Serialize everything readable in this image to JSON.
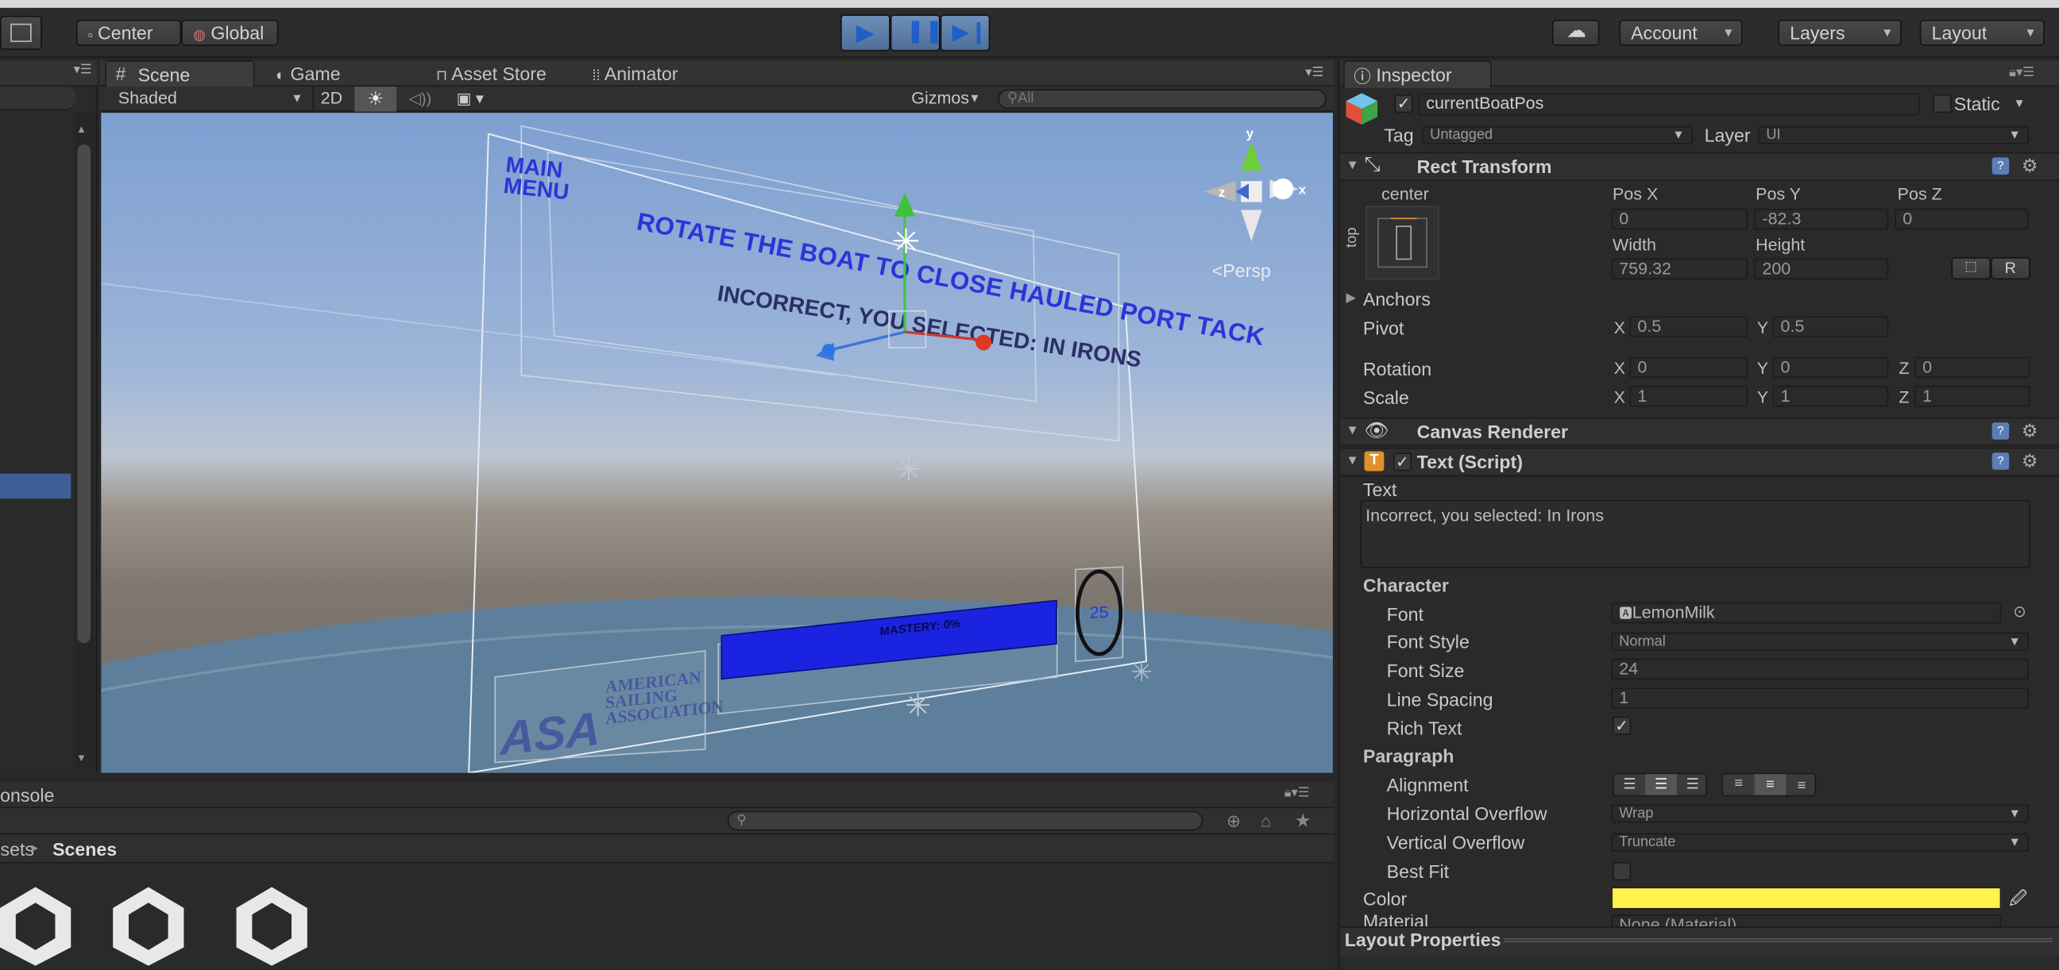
{
  "toolbar": {
    "pivot_label": "Center",
    "space_label": "Global",
    "account_label": "Account",
    "layers_label": "Layers",
    "layout_label": "Layout"
  },
  "tabs": {
    "scene": "Scene",
    "game": "Game",
    "asset_store": "Asset Store",
    "animator": "Animator",
    "inspector": "Inspector",
    "console": "Console"
  },
  "scene_toolbar": {
    "shading": "Shaded",
    "mode_2d": "2D",
    "gizmos": "Gizmos",
    "search_placeholder": "All"
  },
  "scene_view": {
    "main_menu": "MAIN MENU",
    "instruction": "ROTATE THE BOAT TO CLOSE HAULED PORT TACK",
    "feedback": "INCORRECT, YOU SELECTED: IN IRONS",
    "mastery": "MASTERY: 0%",
    "timer": "25",
    "asa_logo": "ASA",
    "asa_name": "AMERICAN SAILING ASSOCIATION",
    "persp": "Persp",
    "axis_y": "y",
    "axis_x": "x",
    "axis_z": "z"
  },
  "project": {
    "breadcrumb_root": "Assets",
    "breadcrumb_current": "Scenes"
  },
  "inspector": {
    "object_name": "currentBoatPos",
    "static_label": "Static",
    "tag_label": "Tag",
    "tag_value": "Untagged",
    "layer_label": "Layer",
    "layer_value": "UI",
    "rect_transform": {
      "title": "Rect Transform",
      "anchor_h": "center",
      "anchor_v": "top",
      "pos_x_label": "Pos X",
      "pos_y_label": "Pos Y",
      "pos_z_label": "Pos Z",
      "pos_x": "0",
      "pos_y": "-82.3",
      "pos_z": "0",
      "width_label": "Width",
      "height_label": "Height",
      "width": "759.32",
      "height": "200",
      "r_button": "R",
      "anchors_label": "Anchors",
      "pivot_label": "Pivot",
      "pivot_x": "0.5",
      "pivot_y": "0.5",
      "rotation_label": "Rotation",
      "rot_x": "0",
      "rot_y": "0",
      "rot_z": "0",
      "scale_label": "Scale",
      "scale_x": "1",
      "scale_y": "1",
      "scale_z": "1",
      "x": "X",
      "y": "Y",
      "z": "Z"
    },
    "canvas_renderer": {
      "title": "Canvas Renderer"
    },
    "text_script": {
      "title": "Text (Script)",
      "text_label": "Text",
      "text_value": "Incorrect, you selected: In Irons",
      "character_label": "Character",
      "font_label": "Font",
      "font_value": "LemonMilk",
      "font_style_label": "Font Style",
      "font_style_value": "Normal",
      "font_size_label": "Font Size",
      "font_size_value": "24",
      "line_spacing_label": "Line Spacing",
      "line_spacing_value": "1",
      "rich_text_label": "Rich Text",
      "rich_text_checked": true,
      "paragraph_label": "Paragraph",
      "alignment_label": "Alignment",
      "h_overflow_label": "Horizontal Overflow",
      "h_overflow_value": "Wrap",
      "v_overflow_label": "Vertical Overflow",
      "v_overflow_value": "Truncate",
      "best_fit_label": "Best Fit",
      "best_fit_checked": false,
      "color_label": "Color",
      "color_value": "#fff34a",
      "material_label": "Material",
      "material_value": "None (Material)"
    },
    "layout_properties": "Layout Properties"
  },
  "colors": {
    "play_accent": "#4a90e0",
    "selection": "#3e5f96",
    "ui_text_blue": "#2d34d8",
    "mastery_bar": "#1a24e0"
  }
}
